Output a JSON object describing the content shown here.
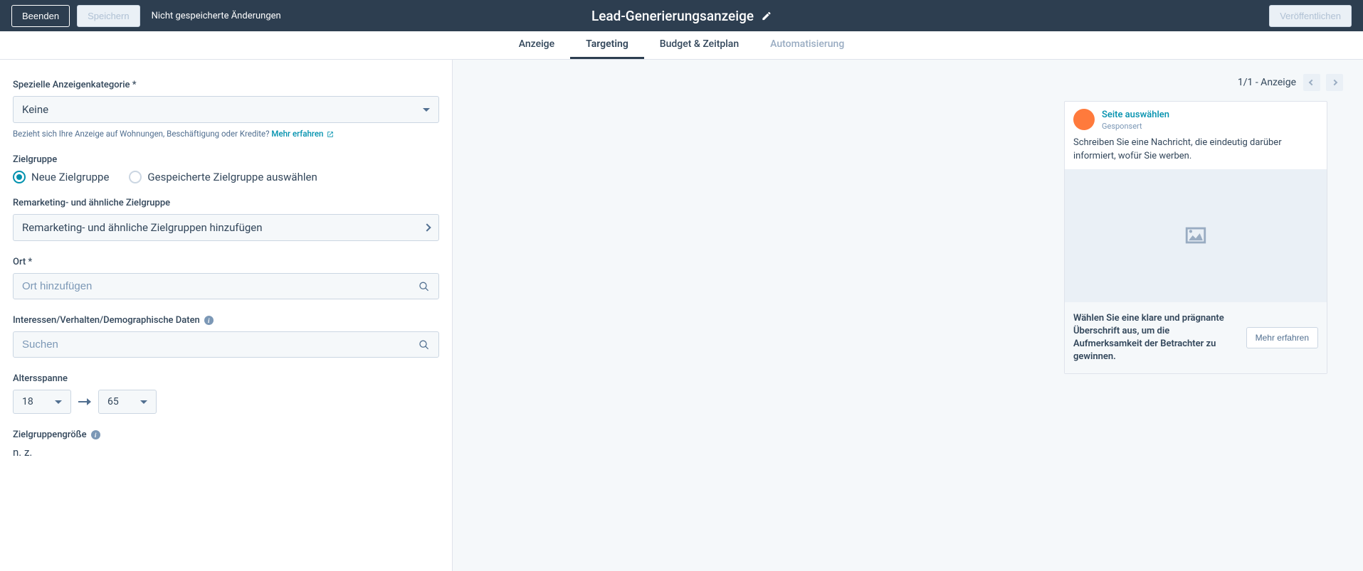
{
  "header": {
    "exit_label": "Beenden",
    "save_label": "Speichern",
    "unsaved_text": "Nicht gespeicherte Änderungen",
    "title": "Lead-Generierungsanzeige",
    "publish_label": "Veröffentlichen"
  },
  "tabs": {
    "anzeige": "Anzeige",
    "targeting": "Targeting",
    "budget": "Budget & Zeitplan",
    "automatisierung": "Automatisierung"
  },
  "form": {
    "category_label": "Spezielle Anzeigenkategorie *",
    "category_value": "Keine",
    "category_help": "Bezieht sich Ihre Anzeige auf Wohnungen, Beschäftigung oder Kredite?",
    "category_help_link": "Mehr erfahren",
    "audience_label": "Zielgruppe",
    "radio_new": "Neue Zielgruppe",
    "radio_saved": "Gespeicherte Zielgruppe auswählen",
    "remarketing_label": "Remarketing- und ähnliche Zielgruppe",
    "remarketing_value": "Remarketing- und ähnliche Zielgruppen hinzufügen",
    "location_label": "Ort *",
    "location_placeholder": "Ort hinzufügen",
    "interests_label": "Interessen/Verhalten/Demographische Daten",
    "interests_placeholder": "Suchen",
    "age_label": "Altersspanne",
    "age_min": "18",
    "age_max": "65",
    "size_label": "Zielgruppengröße",
    "size_value": "n. z."
  },
  "preview": {
    "counter": "1/1 - Anzeige",
    "page_link": "Seite auswählen",
    "sponsored": "Gesponsert",
    "body_text": "Schreiben Sie eine Nachricht, die eindeutig darüber informiert, wofür Sie werben.",
    "headline": "Wählen Sie eine klare und prägnante Überschrift aus, um die Aufmerksamkeit der Betrachter zu gewinnen.",
    "cta": "Mehr erfahren"
  }
}
